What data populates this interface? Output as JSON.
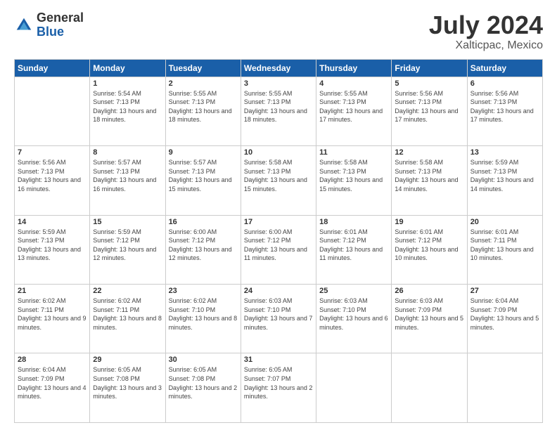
{
  "header": {
    "logo_general": "General",
    "logo_blue": "Blue",
    "month": "July 2024",
    "location": "Xalticpac, Mexico"
  },
  "weekdays": [
    "Sunday",
    "Monday",
    "Tuesday",
    "Wednesday",
    "Thursday",
    "Friday",
    "Saturday"
  ],
  "weeks": [
    [
      {
        "day": "",
        "sunrise": "",
        "sunset": "",
        "daylight": ""
      },
      {
        "day": "1",
        "sunrise": "Sunrise: 5:54 AM",
        "sunset": "Sunset: 7:13 PM",
        "daylight": "Daylight: 13 hours and 18 minutes."
      },
      {
        "day": "2",
        "sunrise": "Sunrise: 5:55 AM",
        "sunset": "Sunset: 7:13 PM",
        "daylight": "Daylight: 13 hours and 18 minutes."
      },
      {
        "day": "3",
        "sunrise": "Sunrise: 5:55 AM",
        "sunset": "Sunset: 7:13 PM",
        "daylight": "Daylight: 13 hours and 18 minutes."
      },
      {
        "day": "4",
        "sunrise": "Sunrise: 5:55 AM",
        "sunset": "Sunset: 7:13 PM",
        "daylight": "Daylight: 13 hours and 17 minutes."
      },
      {
        "day": "5",
        "sunrise": "Sunrise: 5:56 AM",
        "sunset": "Sunset: 7:13 PM",
        "daylight": "Daylight: 13 hours and 17 minutes."
      },
      {
        "day": "6",
        "sunrise": "Sunrise: 5:56 AM",
        "sunset": "Sunset: 7:13 PM",
        "daylight": "Daylight: 13 hours and 17 minutes."
      }
    ],
    [
      {
        "day": "7",
        "sunrise": "Sunrise: 5:56 AM",
        "sunset": "Sunset: 7:13 PM",
        "daylight": "Daylight: 13 hours and 16 minutes."
      },
      {
        "day": "8",
        "sunrise": "Sunrise: 5:57 AM",
        "sunset": "Sunset: 7:13 PM",
        "daylight": "Daylight: 13 hours and 16 minutes."
      },
      {
        "day": "9",
        "sunrise": "Sunrise: 5:57 AM",
        "sunset": "Sunset: 7:13 PM",
        "daylight": "Daylight: 13 hours and 15 minutes."
      },
      {
        "day": "10",
        "sunrise": "Sunrise: 5:58 AM",
        "sunset": "Sunset: 7:13 PM",
        "daylight": "Daylight: 13 hours and 15 minutes."
      },
      {
        "day": "11",
        "sunrise": "Sunrise: 5:58 AM",
        "sunset": "Sunset: 7:13 PM",
        "daylight": "Daylight: 13 hours and 15 minutes."
      },
      {
        "day": "12",
        "sunrise": "Sunrise: 5:58 AM",
        "sunset": "Sunset: 7:13 PM",
        "daylight": "Daylight: 13 hours and 14 minutes."
      },
      {
        "day": "13",
        "sunrise": "Sunrise: 5:59 AM",
        "sunset": "Sunset: 7:13 PM",
        "daylight": "Daylight: 13 hours and 14 minutes."
      }
    ],
    [
      {
        "day": "14",
        "sunrise": "Sunrise: 5:59 AM",
        "sunset": "Sunset: 7:13 PM",
        "daylight": "Daylight: 13 hours and 13 minutes."
      },
      {
        "day": "15",
        "sunrise": "Sunrise: 5:59 AM",
        "sunset": "Sunset: 7:12 PM",
        "daylight": "Daylight: 13 hours and 12 minutes."
      },
      {
        "day": "16",
        "sunrise": "Sunrise: 6:00 AM",
        "sunset": "Sunset: 7:12 PM",
        "daylight": "Daylight: 13 hours and 12 minutes."
      },
      {
        "day": "17",
        "sunrise": "Sunrise: 6:00 AM",
        "sunset": "Sunset: 7:12 PM",
        "daylight": "Daylight: 13 hours and 11 minutes."
      },
      {
        "day": "18",
        "sunrise": "Sunrise: 6:01 AM",
        "sunset": "Sunset: 7:12 PM",
        "daylight": "Daylight: 13 hours and 11 minutes."
      },
      {
        "day": "19",
        "sunrise": "Sunrise: 6:01 AM",
        "sunset": "Sunset: 7:12 PM",
        "daylight": "Daylight: 13 hours and 10 minutes."
      },
      {
        "day": "20",
        "sunrise": "Sunrise: 6:01 AM",
        "sunset": "Sunset: 7:11 PM",
        "daylight": "Daylight: 13 hours and 10 minutes."
      }
    ],
    [
      {
        "day": "21",
        "sunrise": "Sunrise: 6:02 AM",
        "sunset": "Sunset: 7:11 PM",
        "daylight": "Daylight: 13 hours and 9 minutes."
      },
      {
        "day": "22",
        "sunrise": "Sunrise: 6:02 AM",
        "sunset": "Sunset: 7:11 PM",
        "daylight": "Daylight: 13 hours and 8 minutes."
      },
      {
        "day": "23",
        "sunrise": "Sunrise: 6:02 AM",
        "sunset": "Sunset: 7:10 PM",
        "daylight": "Daylight: 13 hours and 8 minutes."
      },
      {
        "day": "24",
        "sunrise": "Sunrise: 6:03 AM",
        "sunset": "Sunset: 7:10 PM",
        "daylight": "Daylight: 13 hours and 7 minutes."
      },
      {
        "day": "25",
        "sunrise": "Sunrise: 6:03 AM",
        "sunset": "Sunset: 7:10 PM",
        "daylight": "Daylight: 13 hours and 6 minutes."
      },
      {
        "day": "26",
        "sunrise": "Sunrise: 6:03 AM",
        "sunset": "Sunset: 7:09 PM",
        "daylight": "Daylight: 13 hours and 5 minutes."
      },
      {
        "day": "27",
        "sunrise": "Sunrise: 6:04 AM",
        "sunset": "Sunset: 7:09 PM",
        "daylight": "Daylight: 13 hours and 5 minutes."
      }
    ],
    [
      {
        "day": "28",
        "sunrise": "Sunrise: 6:04 AM",
        "sunset": "Sunset: 7:09 PM",
        "daylight": "Daylight: 13 hours and 4 minutes."
      },
      {
        "day": "29",
        "sunrise": "Sunrise: 6:05 AM",
        "sunset": "Sunset: 7:08 PM",
        "daylight": "Daylight: 13 hours and 3 minutes."
      },
      {
        "day": "30",
        "sunrise": "Sunrise: 6:05 AM",
        "sunset": "Sunset: 7:08 PM",
        "daylight": "Daylight: 13 hours and 2 minutes."
      },
      {
        "day": "31",
        "sunrise": "Sunrise: 6:05 AM",
        "sunset": "Sunset: 7:07 PM",
        "daylight": "Daylight: 13 hours and 2 minutes."
      },
      {
        "day": "",
        "sunrise": "",
        "sunset": "",
        "daylight": ""
      },
      {
        "day": "",
        "sunrise": "",
        "sunset": "",
        "daylight": ""
      },
      {
        "day": "",
        "sunrise": "",
        "sunset": "",
        "daylight": ""
      }
    ]
  ]
}
